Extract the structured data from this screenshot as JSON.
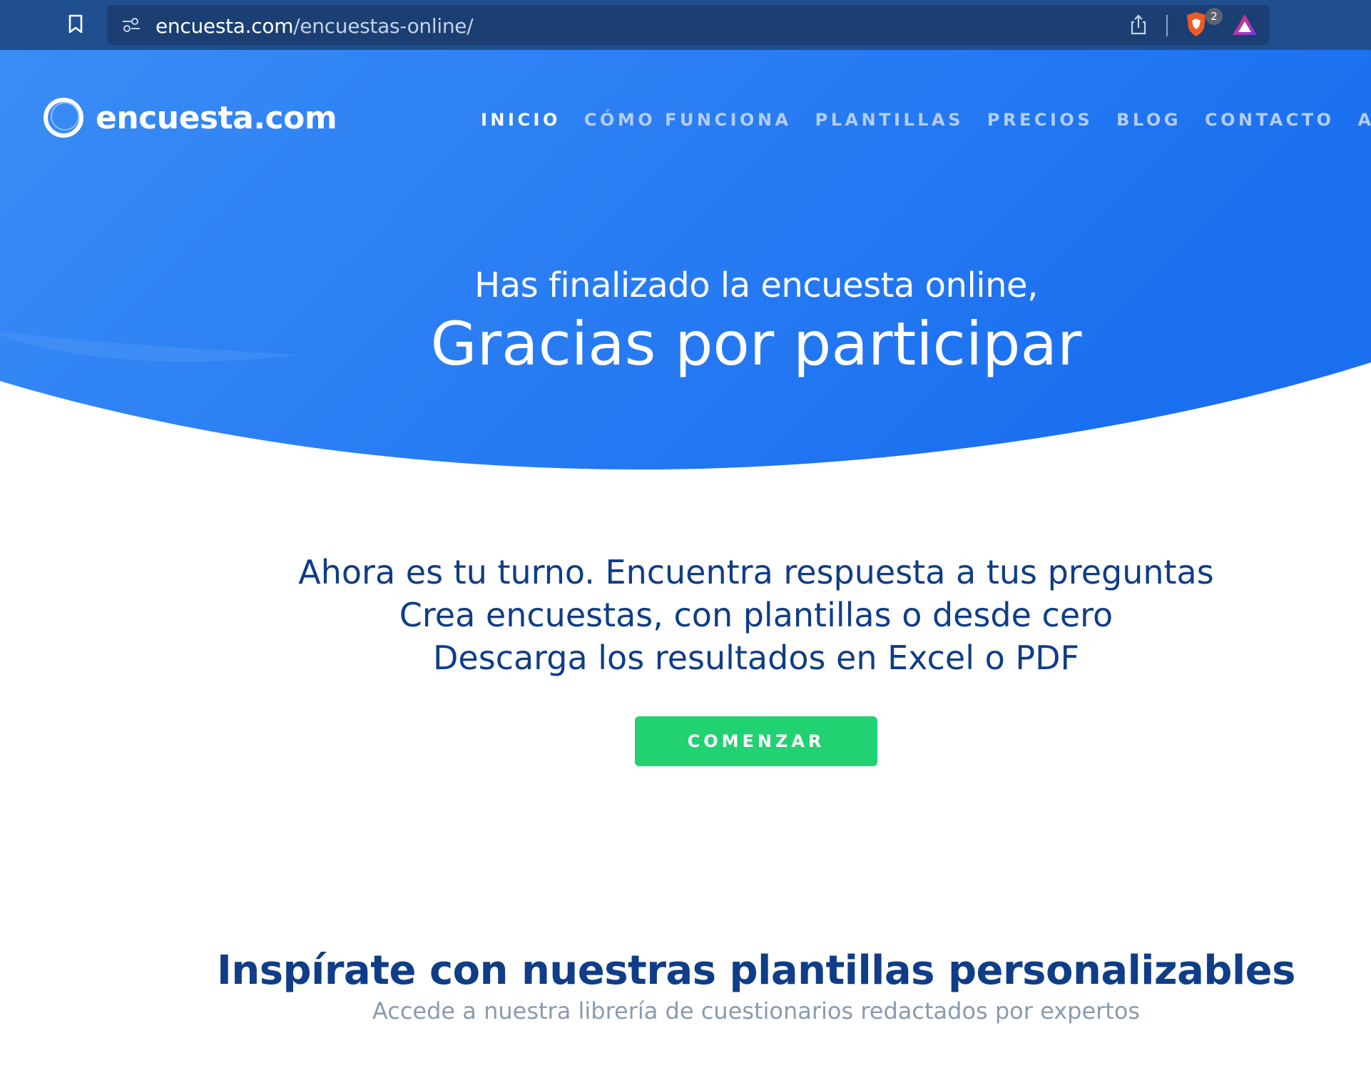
{
  "browser": {
    "url_host": "encuesta.com",
    "url_path": "/encuestas-online/",
    "shield_count": "2",
    "bar_color": "#1f4f8f",
    "icons": [
      "bookmark-icon",
      "site-info-icon",
      "share-icon",
      "brave-shield-icon",
      "brave-rewards-icon"
    ]
  },
  "header": {
    "logo_text": "encuesta.com",
    "nav": [
      {
        "label": "INICIO",
        "active": true
      },
      {
        "label": "CÓMO FUNCIONA",
        "active": false
      },
      {
        "label": "PLANTILLAS",
        "active": false
      },
      {
        "label": "PRECIOS",
        "active": false
      },
      {
        "label": "BLOG",
        "active": false
      },
      {
        "label": "CONTACTO",
        "active": false
      },
      {
        "label": "ACCE",
        "active": false
      }
    ]
  },
  "hero": {
    "subtitle": "Has finalizado la encuesta online,",
    "title": "Gracias por participar",
    "gradient_start": "#3a8cf5",
    "gradient_end": "#1a6ff0"
  },
  "intro": {
    "lines": [
      "Ahora es tu turno. Encuentra respuesta a tus preguntas",
      "Crea encuestas, con plantillas o desde cero",
      "Descarga los resultados en Excel o PDF"
    ],
    "cta_label": "COMENZAR",
    "cta_color": "#22d172",
    "text_color": "#0f3d87"
  },
  "templates_section": {
    "title": "Inspírate con nuestras plantillas personalizables",
    "subtitle": "Accede a nuestra librería de cuestionarios redactados por expertos"
  }
}
